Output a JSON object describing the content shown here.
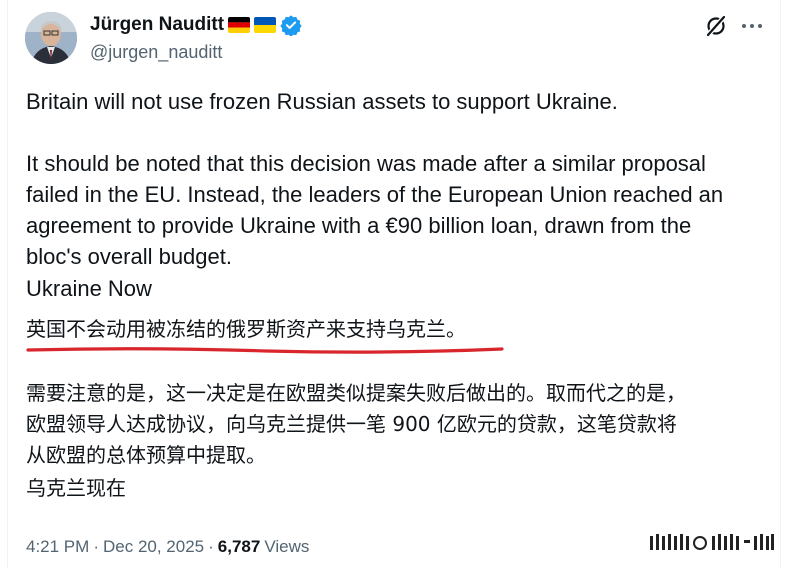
{
  "author": {
    "name": "Jürgen Nauditt",
    "handle": "@jurgen_nauditt",
    "flags": [
      "germany-flag",
      "ukraine-flag"
    ],
    "verified": true
  },
  "header_icons": [
    "grok-icon",
    "more-options-icon"
  ],
  "post": {
    "en_paragraph_1": "Britain will not use frozen Russian assets to support Ukraine.",
    "en_paragraph_2": "It should be noted that this decision was made after a similar proposal\nfailed in the EU. Instead, the leaders of the European Union reached an\nagreement to provide Ukraine with a €90 billion loan, drawn from the\nbloc's overall budget.",
    "en_source": "Ukraine Now",
    "zh_headline": "英国不会动用被冻结的俄罗斯资产来支持乌克兰。",
    "zh_paragraph": "需要注意的是，这一决定是在欧盟类似提案失败后做出的。取而代之的是，\n欧盟领导人达成协议，向乌克兰提供一笔 900 亿欧元的贷款，这笔贷款将\n从欧盟的总体预算中提取。",
    "zh_source": "乌克兰现在"
  },
  "meta": {
    "time": "4:21 PM",
    "separator": "·",
    "date": "Dec 20, 2025",
    "views_count": "6,787",
    "views_label": "Views"
  },
  "colors": {
    "text": "#0f1419",
    "secondary": "#536471",
    "verified": "#1d9bf0",
    "underline": "#d9262c"
  }
}
